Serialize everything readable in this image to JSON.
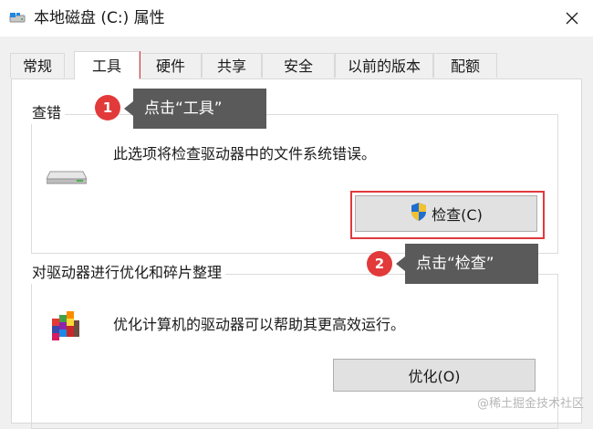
{
  "window": {
    "title": "本地磁盘 (C:) 属性"
  },
  "tabs": [
    {
      "label": "常规",
      "active": false
    },
    {
      "label": "工具",
      "active": true
    },
    {
      "label": "硬件",
      "active": false
    },
    {
      "label": "共享",
      "active": false
    },
    {
      "label": "安全",
      "active": false
    },
    {
      "label": "以前的版本",
      "active": false
    },
    {
      "label": "配额",
      "active": false
    }
  ],
  "error_check": {
    "title": "查错",
    "description": "此选项将检查驱动器中的文件系统错误。",
    "button_label": "检查(C)"
  },
  "optimize": {
    "title": "对驱动器进行优化和碎片整理",
    "description": "优化计算机的驱动器可以帮助其更高效运行。",
    "button_label": "优化(O)"
  },
  "annotations": {
    "step1_number": "1",
    "step1_text": "点击“工具”",
    "step2_number": "2",
    "step2_text": "点击“检查”"
  },
  "watermark": "@稀土掘金技术社区",
  "colors": {
    "highlight_red": "#e0393c",
    "callout_bg": "#5a5a5a",
    "badge_red": "#e23a3a"
  }
}
